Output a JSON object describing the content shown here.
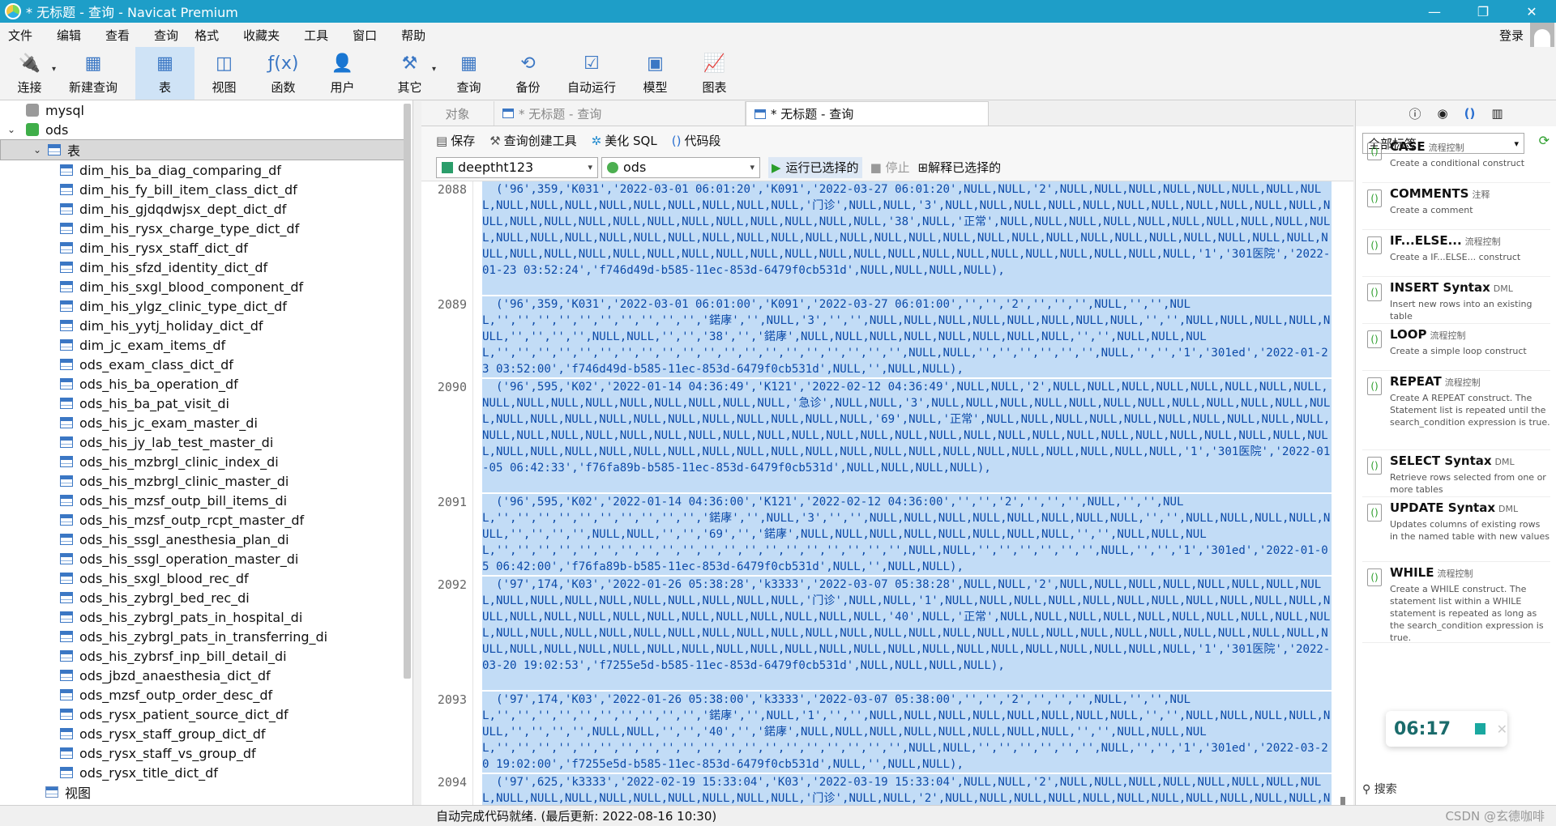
{
  "window": {
    "title": "* 无标题 - 查询 - Navicat Premium",
    "minimize": "—",
    "restore": "❐",
    "close": "✕"
  },
  "menu": [
    "文件",
    "编辑",
    "查看",
    "查询",
    "格式",
    "收藏夹",
    "工具",
    "窗口",
    "帮助"
  ],
  "login": "登录",
  "toolbar": [
    {
      "label": "连接",
      "icon": "plug-icon",
      "glyph": "🔌",
      "caret": true
    },
    {
      "label": "新建查询",
      "icon": "new-query-icon",
      "glyph": "▦"
    },
    {
      "label": "表",
      "icon": "table-icon",
      "glyph": "▦",
      "active": true
    },
    {
      "label": "视图",
      "icon": "view-icon",
      "glyph": "◫"
    },
    {
      "label": "函数",
      "icon": "function-icon",
      "glyph": "ƒ(x)"
    },
    {
      "label": "用户",
      "icon": "user-icon",
      "glyph": "👤"
    },
    {
      "label": "其它",
      "icon": "tools-icon",
      "glyph": "⚒",
      "caret": true
    },
    {
      "label": "查询",
      "icon": "query-icon",
      "glyph": "▦"
    },
    {
      "label": "备份",
      "icon": "backup-icon",
      "glyph": "⟲"
    },
    {
      "label": "自动运行",
      "icon": "schedule-icon",
      "glyph": "☑"
    },
    {
      "label": "模型",
      "icon": "model-icon",
      "glyph": "▣"
    },
    {
      "label": "图表",
      "icon": "chart-icon",
      "glyph": "📈"
    }
  ],
  "tree": {
    "connections": [
      {
        "name": "mysql"
      },
      {
        "name": "ods"
      }
    ],
    "group": "表",
    "tables": [
      "dim_his_ba_diag_comparing_df",
      "dim_his_fy_bill_item_class_dict_df",
      "dim_his_gjdqdwjsx_dept_dict_df",
      "dim_his_rysx_charge_type_dict_df",
      "dim_his_rysx_staff_dict_df",
      "dim_his_sfzd_identity_dict_df",
      "dim_his_sxgl_blood_component_df",
      "dim_his_ylgz_clinic_type_dict_df",
      "dim_his_yytj_holiday_dict_df",
      "dim_jc_exam_items_df",
      "ods_exam_class_dict_df",
      "ods_his_ba_operation_df",
      "ods_his_ba_pat_visit_di",
      "ods_his_jc_exam_master_di",
      "ods_his_jy_lab_test_master_di",
      "ods_his_mzbrgl_clinic_index_di",
      "ods_his_mzbrgl_clinic_master_di",
      "ods_his_mzsf_outp_bill_items_di",
      "ods_his_mzsf_outp_rcpt_master_df",
      "ods_his_ssgl_anesthesia_plan_di",
      "ods_his_ssgl_operation_master_di",
      "ods_his_sxgl_blood_rec_df",
      "ods_his_zybrgl_bed_rec_di",
      "ods_his_zybrgl_pats_in_hospital_di",
      "ods_his_zybrgl_pats_in_transferring_di",
      "ods_his_zybrsf_inp_bill_detail_di",
      "ods_jbzd_anaesthesia_dict_df",
      "ods_mzsf_outp_order_desc_df",
      "ods_rysx_patient_source_dict_df",
      "ods_rysx_staff_group_dict_df",
      "ods_rysx_staff_vs_group_df",
      "ods_rysx_title_dict_df"
    ],
    "views": "视图"
  },
  "tabs": {
    "objects": "对象",
    "inactive": "* 无标题 - 查询",
    "active": "* 无标题 - 查询"
  },
  "qtool": {
    "save": "保存",
    "builder": "查询创建工具",
    "beautify": "美化 SQL",
    "snippet": "代码段"
  },
  "qsel": {
    "connection": "deeptht123",
    "database": "ods",
    "run": "运行已选择的",
    "stop": "停止",
    "explain": "解释已选择的"
  },
  "editor": {
    "lines": [
      {
        "num": "2088",
        "text": "  ('96',359,'K031','2022-03-01 06:01:20','K091','2022-03-27 06:01:20',NULL,NULL,'2',NULL,NULL,NULL,NULL,NULL,NULL,NULL,NULL,NULL,NULL,NULL,NULL,NULL,NULL,NULL,NULL,NULL,'门诊',NULL,NULL,'3',NULL,NULL,NULL,NULL,NULL,NULL,NULL,NULL,NULL,NULL,NULL,NULL,NULL,NULL,NULL,NULL,NULL,NULL,NULL,NULL,NULL,NULL,NULL,'38',NULL,'正常',NULL,NULL,NULL,NULL,NULL,NULL,NULL,NULL,NULL,NULL,NULL,NULL,NULL,NULL,NULL,NULL,NULL,NULL,NULL,NULL,NULL,NULL,NULL,NULL,NULL,NULL,NULL,NULL,NULL,NULL,NULL,NULL,NULL,NULL,NULL,NULL,NULL,NULL,NULL,NULL,NULL,NULL,NULL,NULL,NULL,NULL,NULL,NULL,NULL,NULL,NULL,NULL,NULL,NULL,NULL,'1','301医院','2022-01-23 03:52:24','f746d49d-b585-11ec-853d-6479f0cb531d',NULL,NULL,NULL,NULL),",
        "rows": 7
      },
      {
        "num": "2089",
        "text": "  ('96',359,'K031','2022-03-01 06:01:00','K091','2022-03-27 06:01:00','','','2','','','',NULL,'','',NULL,'','','','','','','','','','','鍩庨','',NULL,'3','','',NULL,NULL,NULL,NULL,NULL,NULL,NULL,NULL,'','',NULL,NULL,NULL,NULL,NULL,'','','','',NULL,NULL,'','','38','','鍩庨',NULL,NULL,NULL,NULL,NULL,NULL,NULL,NULL,'','',NULL,NULL,NULL,'','','','','','','','','','','','','','','','','','','','',NULL,NULL,'','','','','','',NULL,'','','1','301ed','2022-01-23 03:52:00','f746d49d-b585-11ec-853d-6479f0cb531d',NULL,'',NULL,NULL),",
        "rows": 5
      },
      {
        "num": "2090",
        "text": "  ('96',595,'K02','2022-01-14 04:36:49','K121','2022-02-12 04:36:49',NULL,NULL,'2',NULL,NULL,NULL,NULL,NULL,NULL,NULL,NULL,NULL,NULL,NULL,NULL,NULL,NULL,NULL,NULL,NULL,'急诊',NULL,NULL,'3',NULL,NULL,NULL,NULL,NULL,NULL,NULL,NULL,NULL,NULL,NULL,NULL,NULL,NULL,NULL,NULL,NULL,NULL,NULL,NULL,NULL,NULL,NULL,'69',NULL,'正常',NULL,NULL,NULL,NULL,NULL,NULL,NULL,NULL,NULL,NULL,NULL,NULL,NULL,NULL,NULL,NULL,NULL,NULL,NULL,NULL,NULL,NULL,NULL,NULL,NULL,NULL,NULL,NULL,NULL,NULL,NULL,NULL,NULL,NULL,NULL,NULL,NULL,NULL,NULL,NULL,NULL,NULL,NULL,NULL,NULL,NULL,NULL,NULL,NULL,NULL,NULL,NULL,NULL,NULL,NULL,'1','301医院','2022-01-05 06:42:33','f76fa89b-b585-11ec-853d-6479f0cb531d',NULL,NULL,NULL,NULL),",
        "rows": 7
      },
      {
        "num": "2091",
        "text": "  ('96',595,'K02','2022-01-14 04:36:00','K121','2022-02-12 04:36:00','','','2','','','',NULL,'','',NULL,'','','','','','','','','','','鍩庨','',NULL,'3','','',NULL,NULL,NULL,NULL,NULL,NULL,NULL,NULL,'','',NULL,NULL,NULL,NULL,NULL,'','','','',NULL,NULL,'','','69','','鍩庨',NULL,NULL,NULL,NULL,NULL,NULL,NULL,NULL,'','',NULL,NULL,NULL,'','','','','','','','','','','','','','','','','','','','',NULL,NULL,'','','','','','',NULL,'','','1','301ed','2022-01-05 06:42:00','f76fa89b-b585-11ec-853d-6479f0cb531d',NULL,'',NULL,NULL),",
        "rows": 5
      },
      {
        "num": "2092",
        "text": "  ('97',174,'K03','2022-01-26 05:38:28','k3333','2022-03-07 05:38:28',NULL,NULL,'2',NULL,NULL,NULL,NULL,NULL,NULL,NULL,NULL,NULL,NULL,NULL,NULL,NULL,NULL,NULL,NULL,NULL,'门诊',NULL,NULL,'1',NULL,NULL,NULL,NULL,NULL,NULL,NULL,NULL,NULL,NULL,NULL,NULL,NULL,NULL,NULL,NULL,NULL,NULL,NULL,NULL,NULL,NULL,NULL,'40',NULL,'正常',NULL,NULL,NULL,NULL,NULL,NULL,NULL,NULL,NULL,NULL,NULL,NULL,NULL,NULL,NULL,NULL,NULL,NULL,NULL,NULL,NULL,NULL,NULL,NULL,NULL,NULL,NULL,NULL,NULL,NULL,NULL,NULL,NULL,NULL,NULL,NULL,NULL,NULL,NULL,NULL,NULL,NULL,NULL,NULL,NULL,NULL,NULL,NULL,NULL,NULL,NULL,NULL,NULL,NULL,NULL,'1','301医院','2022-03-20 19:02:53','f7255e5d-b585-11ec-853d-6479f0cb531d',NULL,NULL,NULL,NULL),",
        "rows": 7
      },
      {
        "num": "2093",
        "text": "  ('97',174,'K03','2022-01-26 05:38:00','k3333','2022-03-07 05:38:00','','','2','','','',NULL,'','',NULL,'','','','','','','','','','','鍩庨','',NULL,'1','','',NULL,NULL,NULL,NULL,NULL,NULL,NULL,NULL,'','',NULL,NULL,NULL,NULL,NULL,'','','','',NULL,NULL,'','','40','','鍩庨',NULL,NULL,NULL,NULL,NULL,NULL,NULL,NULL,'','',NULL,NULL,NULL,'','','','','','','','','','','','','','','','','','','','',NULL,NULL,'','','','','','',NULL,'','','1','301ed','2022-03-20 19:02:00','f7255e5d-b585-11ec-853d-6479f0cb531d',NULL,'',NULL,NULL),",
        "rows": 5
      },
      {
        "num": "2094",
        "text": "  ('97',625,'k3333','2022-02-19 15:33:04','K03','2022-03-19 15:33:04',NULL,NULL,'2',NULL,NULL,NULL,NULL,NULL,NULL,NULL,NULL,NULL,NULL,NULL,NULL,NULL,NULL,NULL,NULL,NULL,'门诊',NULL,NULL,'2',NULL,NULL,NULL,NULL,NULL,NULL,NULL,NULL,NULL,NULL,NULL,NULL",
        "rows": 2
      }
    ]
  },
  "rpanel": {
    "icons": [
      "ⓘ",
      "◉",
      "()",
      "▥"
    ],
    "tag": "全部标签",
    "snippets": [
      {
        "name": "CASE",
        "cat": "流程控制",
        "desc": "Create a conditional construct"
      },
      {
        "name": "COMMENTS",
        "cat": "注释",
        "desc": "Create a comment"
      },
      {
        "name": "IF...ELSE...",
        "cat": "流程控制",
        "desc": "Create a IF...ELSE... construct"
      },
      {
        "name": "INSERT Syntax",
        "cat": "DML",
        "desc": "Insert new rows into an existing table"
      },
      {
        "name": "LOOP",
        "cat": "流程控制",
        "desc": "Create a simple loop construct"
      },
      {
        "name": "REPEAT",
        "cat": "流程控制",
        "desc": "Create A REPEAT construct. The Statement list is repeated until the search_condition expression is true."
      },
      {
        "name": "SELECT Syntax",
        "cat": "DML",
        "desc": "Retrieve rows selected from one or more tables"
      },
      {
        "name": "UPDATE Syntax",
        "cat": "DML",
        "desc": "Updates columns of existing rows in the named table with new values"
      },
      {
        "name": "WHILE",
        "cat": "流程控制",
        "desc": "Create a WHILE construct. The statement list within a WHILE statement is repeated as long as the search_condition expression is true."
      }
    ],
    "search": "搜索",
    "timer": "06:17"
  },
  "status": {
    "text": "自动完成代码就绪. (最后更新: 2022-08-16 10:30)",
    "watermark": "CSDN @玄德咖啡"
  }
}
